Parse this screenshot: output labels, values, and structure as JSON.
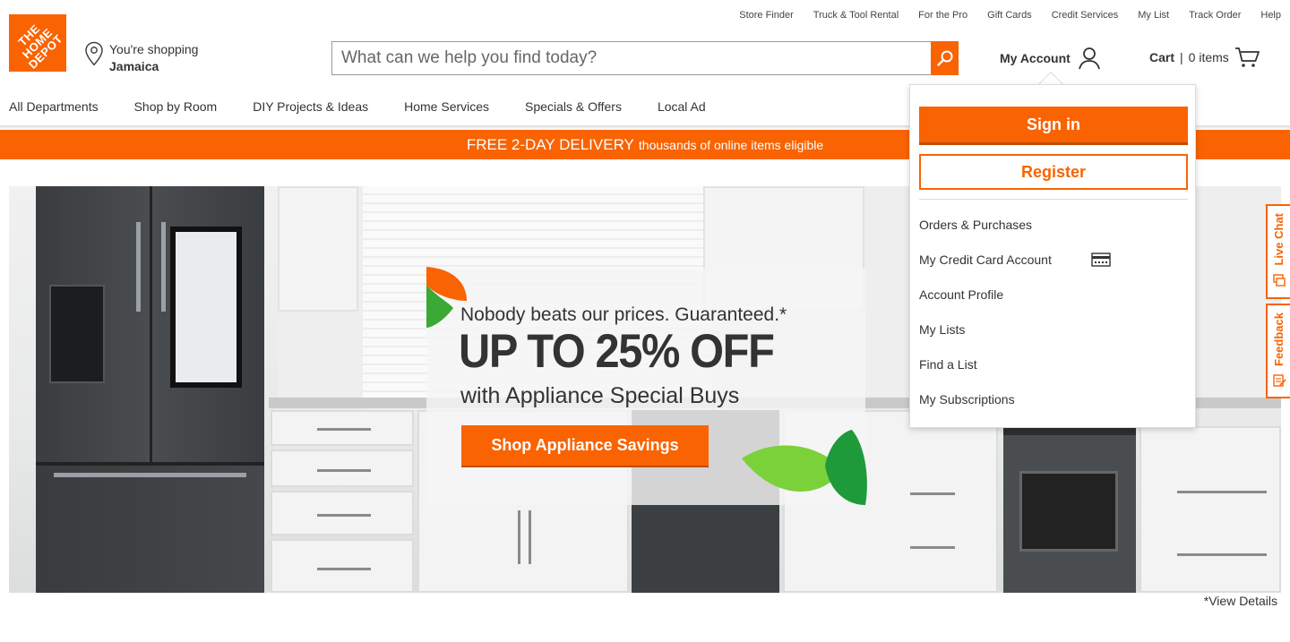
{
  "utility_links": [
    "Store Finder",
    "Truck & Tool Rental",
    "For the Pro",
    "Gift Cards",
    "Credit Services",
    "My List",
    "Track Order",
    "Help"
  ],
  "logo": {
    "text": "THE\nHOME\nDEPOT",
    "color": "#f96302"
  },
  "store": {
    "label": "You're shopping",
    "name": "Jamaica",
    "icon": "location-pin-icon"
  },
  "search": {
    "placeholder": "What can we help you find today?",
    "icon": "search-icon"
  },
  "account": {
    "label": "My Account",
    "icon": "user-icon"
  },
  "cart": {
    "label": "Cart",
    "separator": "|",
    "count": "0 items",
    "icon": "cart-icon"
  },
  "nav": [
    "All Departments",
    "Shop by Room",
    "DIY Projects & Ideas",
    "Home Services",
    "Specials & Offers",
    "Local Ad"
  ],
  "promo": {
    "big": "FREE 2-DAY DELIVERY",
    "small": "thousands of online items eligible"
  },
  "hero": {
    "tagline": "Nobody beats our prices. Guaranteed.*",
    "headline": "UP TO 25% OFF",
    "sub": "with Appliance Special Buys",
    "cta": "Shop Appliance Savings",
    "details": "*View Details"
  },
  "side_tabs": {
    "chat": "Live Chat",
    "feedback": "Feedback"
  },
  "dropdown": {
    "sign_in": "Sign in",
    "register": "Register",
    "items": [
      "Orders & Purchases",
      "My Credit Card Account",
      "Account Profile",
      "My Lists",
      "Find a List",
      "My Subscriptions"
    ]
  },
  "colors": {
    "brand": "#f96302",
    "text": "#333333"
  }
}
